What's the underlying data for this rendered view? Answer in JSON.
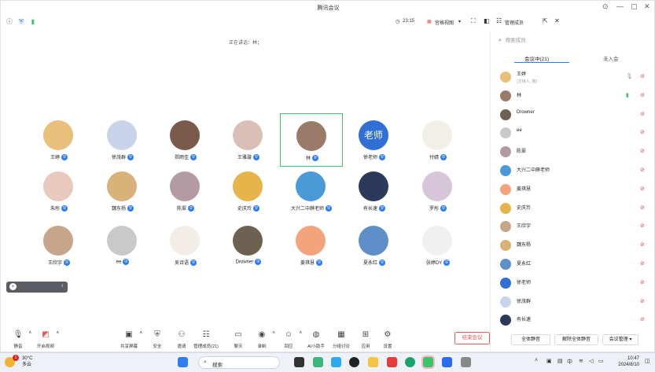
{
  "window": {
    "title": "腾讯会议"
  },
  "topbar": {
    "timer": "23:15",
    "view_label": "宫格视图",
    "manage_members": "管理成员"
  },
  "speaking": "正在讲话：林；",
  "grid": [
    {
      "name": "王婷",
      "color": "#e8c07a"
    },
    {
      "name": "徐茂群",
      "color": "#c9d3ea"
    },
    {
      "name": "郑雨佳",
      "color": "#7a5a4a"
    },
    {
      "name": "王雅璇",
      "color": "#d9bfb6"
    },
    {
      "name": "林",
      "color": "#9a7a68"
    },
    {
      "name": "徐老师",
      "color": "#2f6fd6",
      "text": "老师"
    },
    {
      "name": "付婧",
      "color": "#f2efe8"
    },
    {
      "name": "朱彤",
      "color": "#e9c9bd"
    },
    {
      "name": "魏东杨",
      "color": "#d9b27a"
    },
    {
      "name": "陈翠",
      "color": "#b49aa2"
    },
    {
      "name": "史庆玲",
      "color": "#e5b44a"
    },
    {
      "name": "大兴二中薛老师",
      "color": "#4a9ad8"
    },
    {
      "name": "有长速",
      "color": "#2b3a5a"
    },
    {
      "name": "罗彤",
      "color": "#d7c6d9"
    },
    {
      "name": "王欣宇",
      "color": "#c7a58a"
    },
    {
      "name": "ee",
      "color": "#c9c9c9"
    },
    {
      "name": "吴诗语",
      "color": "#f2ede6"
    },
    {
      "name": "Drowner",
      "color": "#6d6252"
    },
    {
      "name": "姜琪慧",
      "color": "#f4a47c"
    },
    {
      "name": "夏永红",
      "color": "#5e8fc9"
    },
    {
      "name": "张婷DY",
      "color": "#f0f0f0"
    }
  ],
  "float_pill": {
    "label": ""
  },
  "toolbar": {
    "left": [
      {
        "label": "静音",
        "icon": "mic-icon"
      },
      {
        "label": "开启视频",
        "icon": "camera-off-icon"
      }
    ],
    "center": [
      {
        "label": "共享屏幕",
        "icon": "share-screen-icon"
      },
      {
        "label": "安全",
        "icon": "shield-icon"
      },
      {
        "label": "邀请",
        "icon": "invite-icon"
      },
      {
        "label": "管理成员(21)",
        "icon": "members-icon"
      },
      {
        "label": "聊天",
        "icon": "chat-icon"
      },
      {
        "label": "录制",
        "icon": "record-icon"
      },
      {
        "label": "回应",
        "icon": "reaction-icon"
      },
      {
        "label": "AI小助手",
        "icon": "ai-assistant-icon"
      },
      {
        "label": "分组讨论",
        "icon": "breakout-icon"
      },
      {
        "label": "应用",
        "icon": "apps-icon"
      },
      {
        "label": "设置",
        "icon": "settings-icon"
      }
    ],
    "end_meeting": "结束会议"
  },
  "sidebar": {
    "search_placeholder": "搜索成员",
    "tab_in_meeting": "会议中(21)",
    "tab_not_joined": "未入会",
    "participants": [
      {
        "name": "王婷",
        "sub": "(主持人, 我)",
        "color": "#e8c07a",
        "mic_on": true
      },
      {
        "name": "林",
        "color": "#9a7a68",
        "mic_on": true,
        "speaking": true
      },
      {
        "name": "Drowner",
        "color": "#6d6252"
      },
      {
        "name": "ee",
        "color": "#c9c9c9"
      },
      {
        "name": "陈翠",
        "color": "#b49aa2"
      },
      {
        "name": "大兴二中薛老师",
        "color": "#4a9ad8"
      },
      {
        "name": "姜琪慧",
        "color": "#f4a47c"
      },
      {
        "name": "史庆玲",
        "color": "#e5b44a"
      },
      {
        "name": "王欣宇",
        "color": "#c7a58a"
      },
      {
        "name": "魏东杨",
        "color": "#d9b27a"
      },
      {
        "name": "夏永红",
        "color": "#5e8fc9"
      },
      {
        "name": "徐老师",
        "color": "#2f6fd6"
      },
      {
        "name": "徐茂群",
        "color": "#c9d3ea"
      },
      {
        "name": "有长速",
        "color": "#2b3a5a"
      }
    ],
    "mute_all": "全体静音",
    "unmute_all": "解除全体静音",
    "meeting_mgmt": "会议管理"
  },
  "taskbar": {
    "weather_temp": "30°C",
    "weather_text": "多云",
    "search": "搜索",
    "time": "10:47",
    "date": "2024/8/10",
    "notification_count": "1"
  }
}
